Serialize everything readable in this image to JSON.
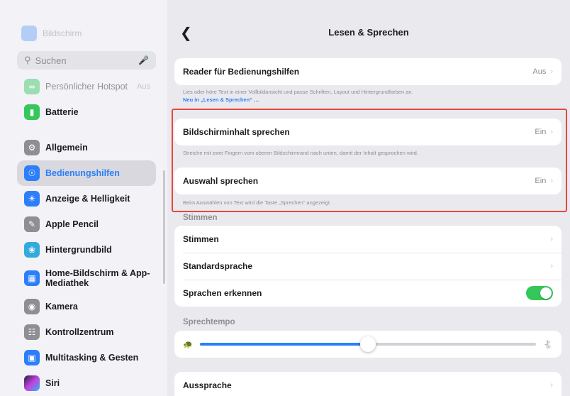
{
  "sidebar": {
    "top_faded_label": "Bildschirm",
    "search_placeholder": "Suchen",
    "items": [
      {
        "label": "Persönlicher Hotspot",
        "value": "Aus",
        "color": "#34c759",
        "icon": "hotspot-icon",
        "faded": true
      },
      {
        "label": "Batterie",
        "value": "",
        "color": "#34c759",
        "icon": "battery-icon"
      },
      {
        "label": "Allgemein",
        "value": "",
        "color": "#8e8e93",
        "icon": "gear-icon"
      },
      {
        "label": "Bedienungshilfen",
        "value": "",
        "color": "#2d7ff9",
        "icon": "accessibility-icon",
        "selected": true
      },
      {
        "label": "Anzeige & Helligkeit",
        "value": "",
        "color": "#2d7ff9",
        "icon": "brightness-icon"
      },
      {
        "label": "Apple Pencil",
        "value": "",
        "color": "#8e8e93",
        "icon": "pencil-icon"
      },
      {
        "label": "Hintergrundbild",
        "value": "",
        "color": "#34aadc",
        "icon": "wallpaper-icon"
      },
      {
        "label": "Home-Bildschirm & App-Mediathek",
        "value": "",
        "color": "#2d7ff9",
        "icon": "home-screen-icon"
      },
      {
        "label": "Kamera",
        "value": "",
        "color": "#8e8e93",
        "icon": "camera-icon"
      },
      {
        "label": "Kontrollzentrum",
        "value": "",
        "color": "#8e8e93",
        "icon": "control-center-icon"
      },
      {
        "label": "Multitasking & Gesten",
        "value": "",
        "color": "#2d7ff9",
        "icon": "multitasking-icon"
      },
      {
        "label": "Siri",
        "value": "",
        "color": "#3a3a8c",
        "icon": "siri-icon"
      }
    ]
  },
  "main": {
    "back_glyph": "❮",
    "title": "Lesen & Sprechen",
    "reader": {
      "label": "Reader für Bedienungshilfen",
      "value": "Aus",
      "footnote": "Lies oder höre Text in einer Vollbildansicht und passe Schriften, Layout und Hintergrundfarben an.",
      "link": "Neu in „Lesen & Sprechen“ …"
    },
    "speak_screen": {
      "label": "Bildschirminhalt sprechen",
      "value": "Ein",
      "footnote": "Streiche mit zwei Fingern vom oberen Bildschirmrand nach unten, damit der Inhalt gesprochen wird."
    },
    "speak_selection": {
      "label": "Auswahl sprechen",
      "value": "Ein",
      "footnote": "Beim Auswählen von Text wird die Taste „Sprechen“ angezeigt."
    },
    "voices_header": "Stimmen",
    "voices_rows": [
      {
        "label": "Stimmen"
      },
      {
        "label": "Standardsprache"
      }
    ],
    "detect_languages": {
      "label": "Sprachen erkennen",
      "on": true
    },
    "speech_rate_header": "Sprechtempo",
    "speech_rate": 0.5,
    "pronunciation": {
      "label": "Aussprache"
    },
    "chevron_glyph": "›"
  },
  "colors": {
    "accent": "#2d7ff9",
    "toggle_on": "#34c759",
    "highlight_box": "#e8473c"
  }
}
